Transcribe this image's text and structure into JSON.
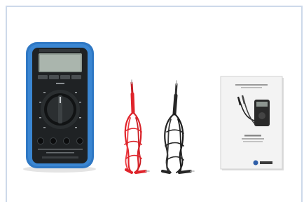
{
  "image": {
    "subject": "multimeter-kit-contents",
    "items": [
      {
        "name": "digital-multimeter",
        "icon": "multimeter-icon"
      },
      {
        "name": "red-test-lead",
        "icon": "test-lead-icon"
      },
      {
        "name": "black-test-lead",
        "icon": "test-lead-icon"
      },
      {
        "name": "instruction-manual",
        "icon": "manual-icon"
      }
    ]
  },
  "colors": {
    "frame_border": "#cdd9ea",
    "meter_holster": "#2f78c4",
    "meter_body": "#1f2224",
    "lcd": "#aab5ad",
    "red_lead": "#e0242b",
    "black_lead": "#262626",
    "manual_paper": "#f3f3f3"
  }
}
